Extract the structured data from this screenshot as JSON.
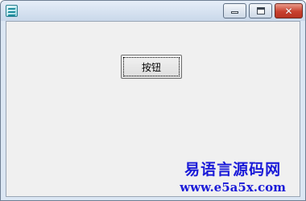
{
  "window": {
    "icon": "app-icon",
    "controls": {
      "minimize_icon": "minimize-icon",
      "maximize_icon": "maximize-icon",
      "close_icon": "close-icon",
      "close_glyph": "✕"
    },
    "title_gradient": [
      "#e6eef8",
      "#c9d8ea"
    ],
    "close_color": "#c8412f"
  },
  "form": {
    "background": "#f0f0f0",
    "button_label": "按钮"
  },
  "watermark": {
    "site_name": "易语言源码网",
    "url": "www.e5a5x.com",
    "color": "#1b1bd8"
  }
}
